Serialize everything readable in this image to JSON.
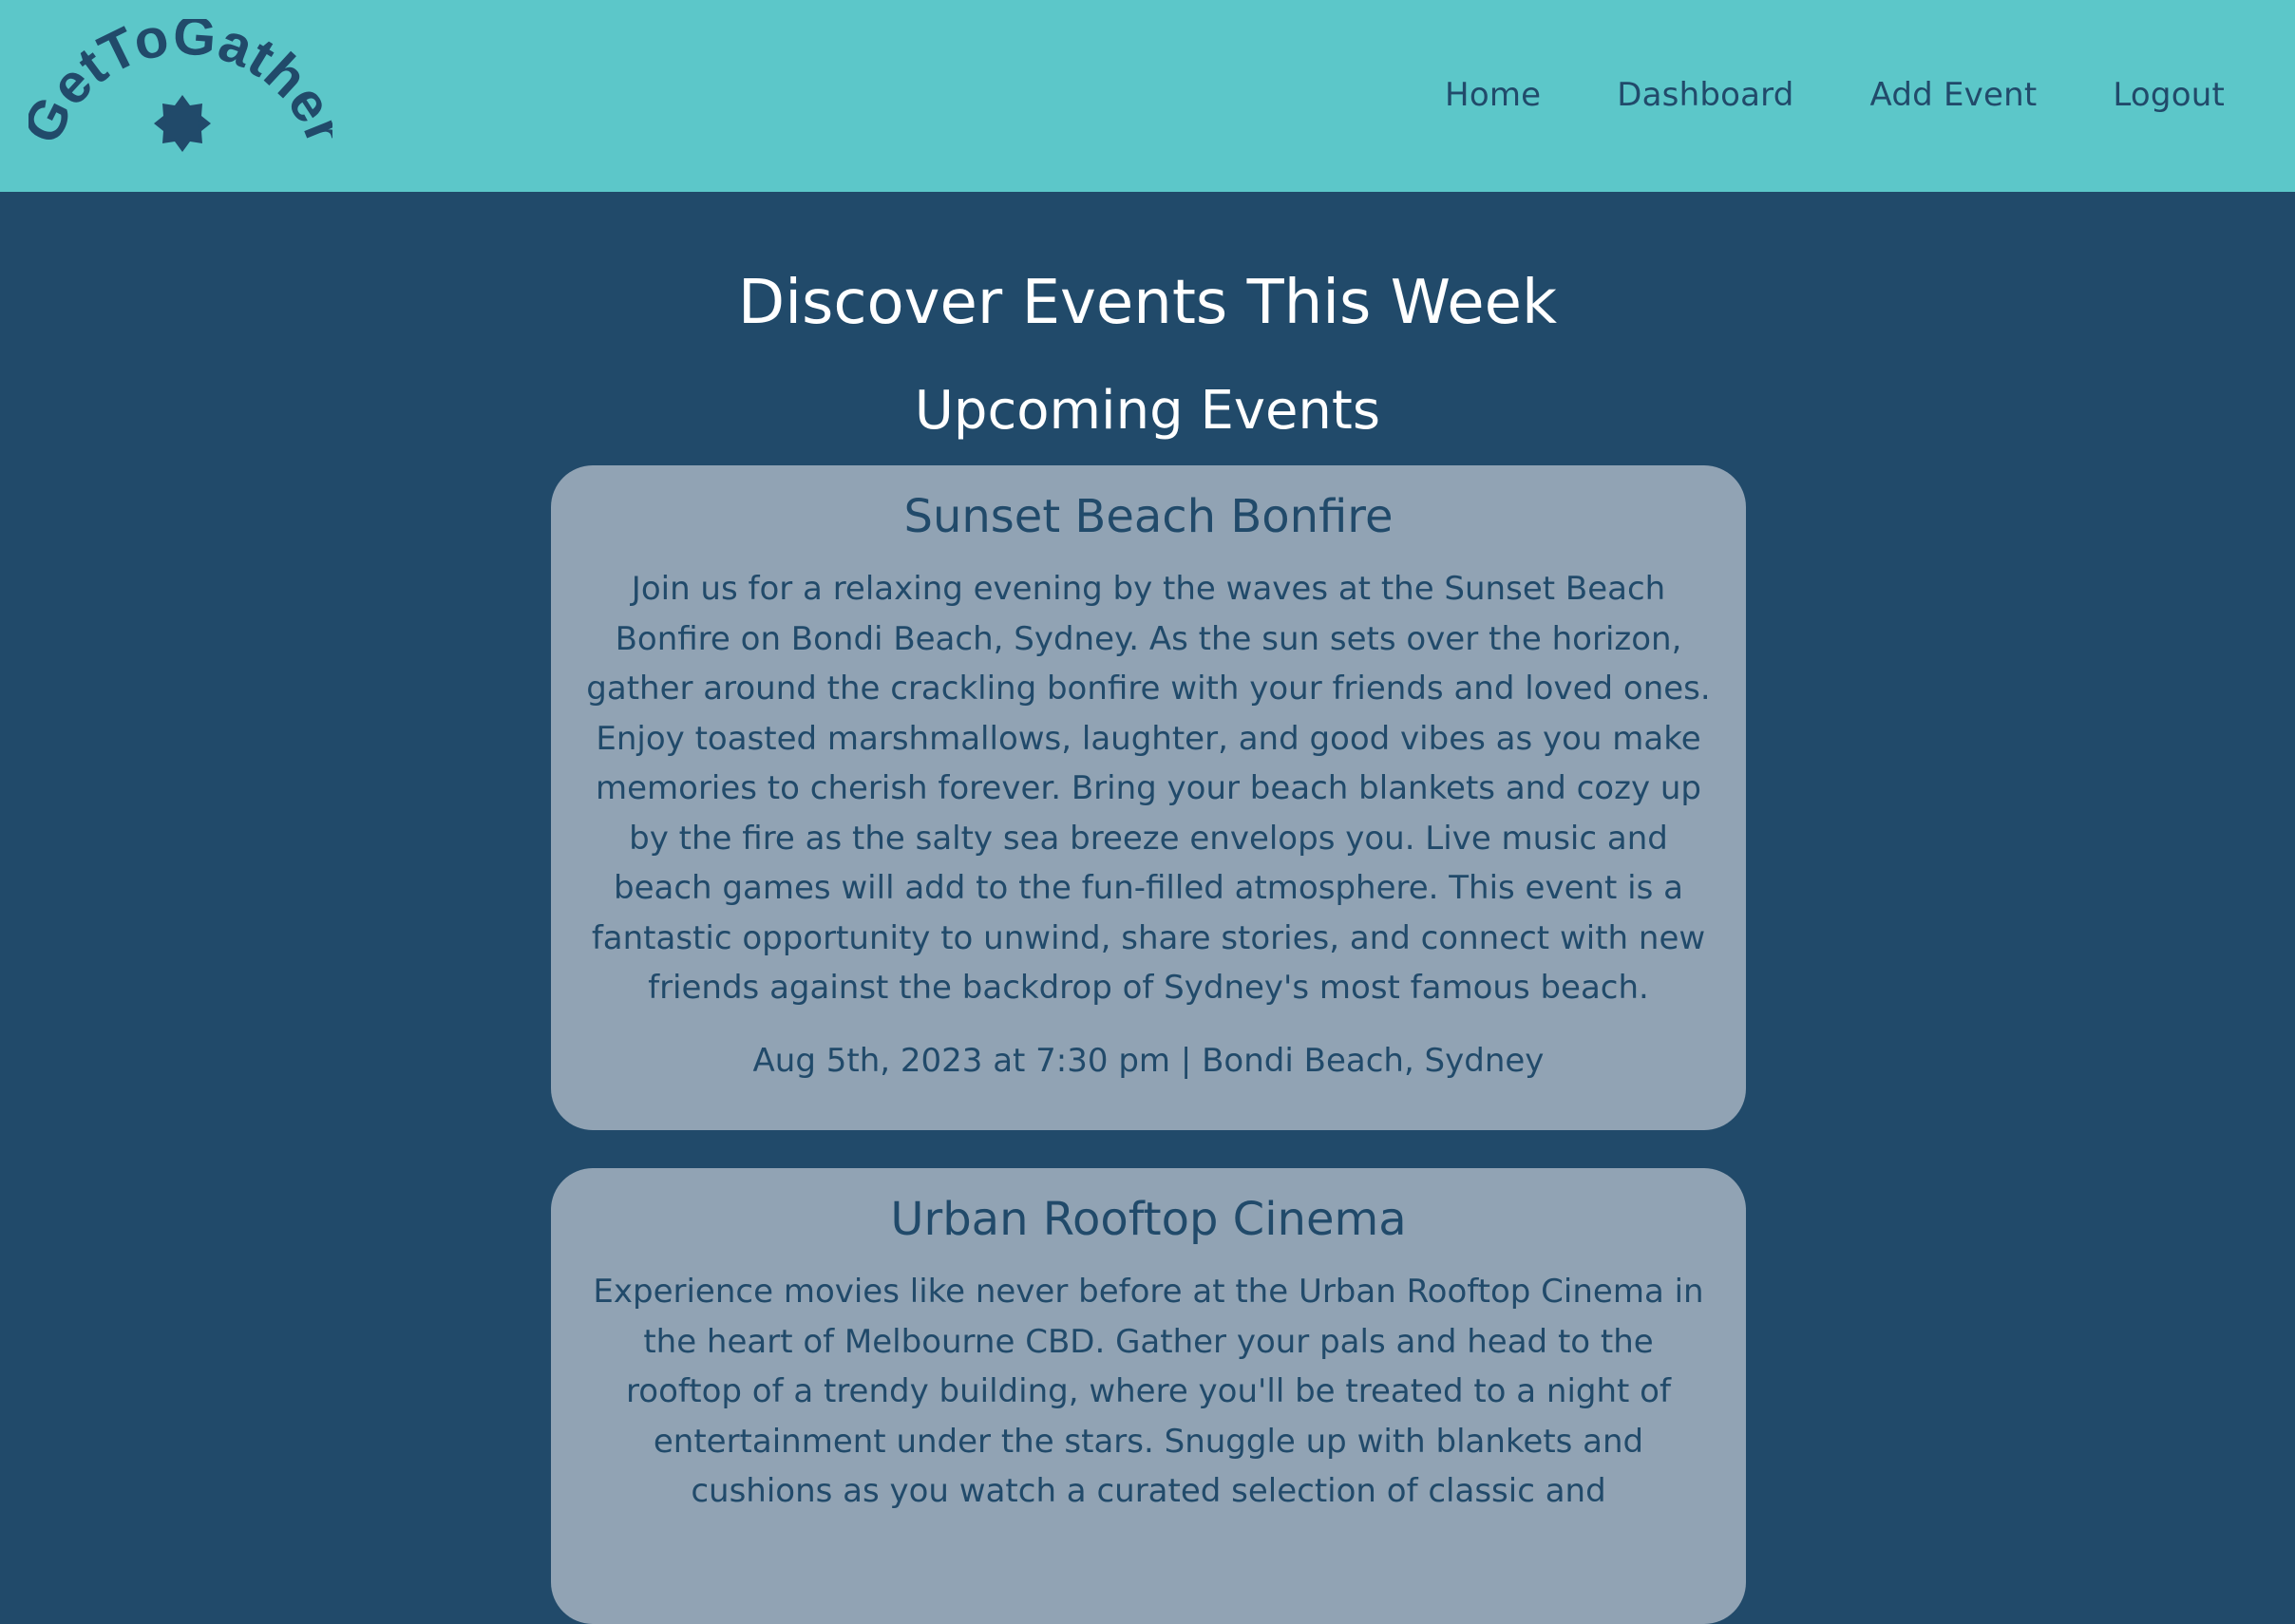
{
  "header": {
    "logo_text": "GetToGather",
    "nav": [
      {
        "label": "Home"
      },
      {
        "label": "Dashboard"
      },
      {
        "label": "Add Event"
      },
      {
        "label": "Logout"
      }
    ]
  },
  "main": {
    "page_title": "Discover Events This Week",
    "section_title": "Upcoming Events",
    "events": [
      {
        "title": "Sunset Beach Bonfire",
        "description": "Join us for a relaxing evening by the waves at the Sunset Beach Bonfire on Bondi Beach, Sydney. As the sun sets over the horizon, gather around the crackling bonfire with your friends and loved ones. Enjoy toasted marshmallows, laughter, and good vibes as you make memories to cherish forever. Bring your beach blankets and cozy up by the fire as the salty sea breeze envelops you. Live music and beach games will add to the fun-filled atmosphere. This event is a fantastic opportunity to unwind, share stories, and connect with new friends against the backdrop of Sydney's most famous beach.",
        "meta": "Aug 5th, 2023 at 7:30 pm | Bondi Beach, Sydney"
      },
      {
        "title": "Urban Rooftop Cinema",
        "description": "Experience movies like never before at the Urban Rooftop Cinema in the heart of Melbourne CBD. Gather your pals and head to the rooftop of a trendy building, where you'll be treated to a night of entertainment under the stars. Snuggle up with blankets and cushions as you watch a curated selection of classic and"
      }
    ]
  },
  "colors": {
    "header_bg": "#5cc7c9",
    "page_bg": "#214a6a",
    "card_bg": "#91a3b4",
    "text_dark": "#214a6a",
    "text_light": "#ffffff"
  },
  "icons": {
    "logo_mark": "badge-star-icon"
  }
}
